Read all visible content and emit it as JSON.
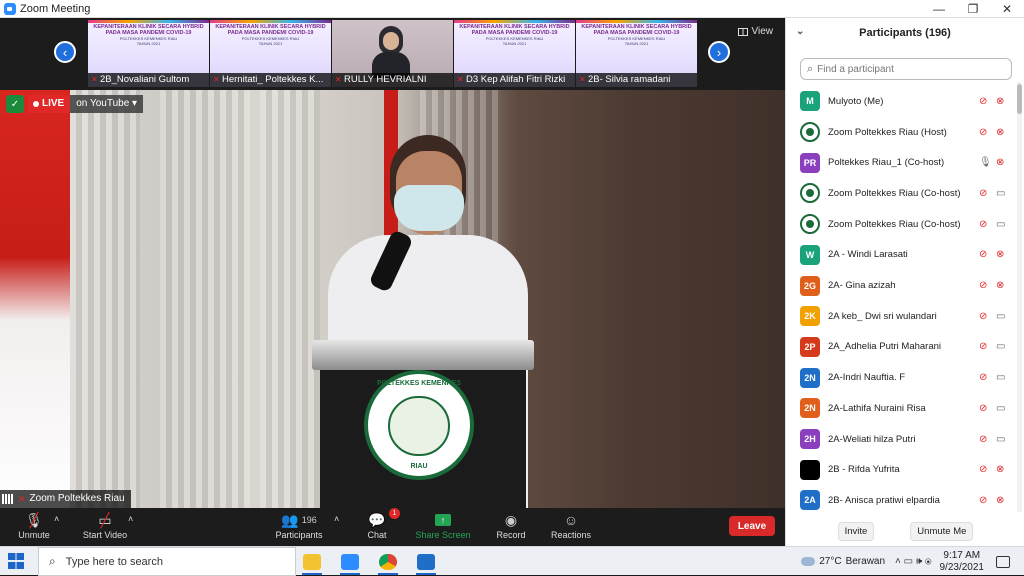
{
  "window": {
    "title": "Zoom Meeting",
    "minimize": "—",
    "maximize": "❐",
    "close": "✕"
  },
  "thumbnails": [
    {
      "name": "2B_Novaliani Gultom",
      "banner1": "KEPANITERAAN KLINIK SECARA HYBRID",
      "banner2": "PADA MASA PANDEMI COVID-19",
      "banner3": "POLTEKKES KEMENKES RIAU",
      "banner4": "TAHUN 2021"
    },
    {
      "name": "Hernitati_ Poltekkes K...",
      "banner1": "KEPANITERAAN KLINIK SECARA HYBRID",
      "banner2": "PADA MASA PANDEMI COVID-19",
      "banner3": "POLTEKKES KEMENKES RIAU",
      "banner4": "TAHUN 2021"
    },
    {
      "name": "RULLY HEVRIALNI"
    },
    {
      "name": "D3 Kep Alifah Fitri Rizki",
      "banner1": "KEPANITERAAN KLINIK SECARA HYBRID",
      "banner2": "PADA MASA PANDEMI COVID-19",
      "banner3": "POLTEKKES KEMENKES RIAU",
      "banner4": "TAHUN 2021"
    },
    {
      "name": "2B- Silvia ramadani",
      "banner1": "KEPANITERAAN KLINIK SECARA HYBRID",
      "banner2": "PADA MASA PANDEMI COVID-19",
      "banner3": "POLTEKKES KEMENKES RIAU",
      "banner4": "TAHUN 2021"
    }
  ],
  "view_label": "View",
  "live": {
    "live_label": "LIVE",
    "platform": "on YouTube ▾"
  },
  "speaker": {
    "name": "Zoom Poltekkes Riau",
    "podium_top": "POLTEKKES KEMENKES",
    "podium_bottom": "RIAU"
  },
  "toolbar": {
    "unmute": "Unmute",
    "start_video": "Start Video",
    "participants": "Participants",
    "participant_count": "196",
    "chat": "Chat",
    "chat_badge": "1",
    "share_screen": "Share Screen",
    "record": "Record",
    "reactions": "Reactions",
    "leave": "Leave"
  },
  "panel": {
    "title": "Participants (196)",
    "search_placeholder": "Find a participant",
    "invite": "Invite",
    "unmute_me": "Unmute Me",
    "participants": [
      {
        "avatar": "M",
        "color": "#1aa37a",
        "name": "Mulyoto (Me)",
        "mic": "muted",
        "video": "off"
      },
      {
        "avatar": "logo",
        "color": "#1b6b3a",
        "name": "Zoom Poltekkes Riau (Host)",
        "mic": "muted",
        "video": "off"
      },
      {
        "avatar": "PR",
        "color": "#8a3fbf",
        "name": "Poltekkes Riau_1 (Co-host)",
        "mic": "on",
        "video": "off"
      },
      {
        "avatar": "logo",
        "color": "#1b6b3a",
        "name": "Zoom Poltekkes Riau (Co-host)",
        "mic": "muted",
        "video": "on"
      },
      {
        "avatar": "logo",
        "color": "#1b6b3a",
        "name": "Zoom Poltekkes Riau (Co-host)",
        "mic": "muted",
        "video": "on"
      },
      {
        "avatar": "W",
        "color": "#1aa37a",
        "name": "2A - Windi Larasati",
        "mic": "muted",
        "video": "off"
      },
      {
        "avatar": "2G",
        "color": "#e0601b",
        "name": "2A- Gina azizah",
        "mic": "muted",
        "video": "off"
      },
      {
        "avatar": "2K",
        "color": "#f2a100",
        "name": "2A keb_ Dwi sri wulandari",
        "mic": "muted",
        "video": "on"
      },
      {
        "avatar": "2P",
        "color": "#d63a1c",
        "name": "2A_Adhelia Putri Maharani",
        "mic": "muted",
        "video": "on"
      },
      {
        "avatar": "2N",
        "color": "#1f6fc8",
        "name": "2A-Indri Nauftia. F",
        "mic": "muted",
        "video": "on"
      },
      {
        "avatar": "2N",
        "color": "#e0601b",
        "name": "2A-Lathifa Nuraini Risa",
        "mic": "muted",
        "video": "on"
      },
      {
        "avatar": "2H",
        "color": "#8a3fbf",
        "name": "2A-Weliati hilza Putri",
        "mic": "muted",
        "video": "on"
      },
      {
        "avatar": "",
        "color": "#000000",
        "name": "2B - Rifda Yufrita",
        "mic": "muted",
        "video": "off"
      },
      {
        "avatar": "2A",
        "color": "#1f6fc8",
        "name": "2B- Anisca pratiwi elpardia",
        "mic": "muted",
        "video": "off"
      }
    ]
  },
  "taskbar": {
    "search_text": "Type here to search",
    "temperature": "27°C",
    "weather": "Berawan",
    "time": "9:17 AM",
    "date": "9/23/2021"
  },
  "colors": {
    "accent": "#2d8cff",
    "leave": "#d82a2a",
    "muted": "#e02828",
    "share": "#23a455"
  }
}
